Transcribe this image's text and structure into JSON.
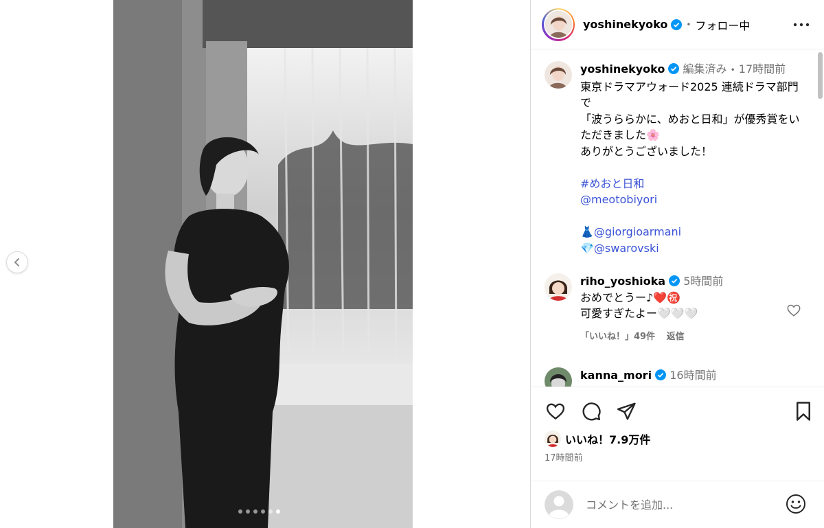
{
  "post": {
    "author": "yoshinekyoko",
    "follow_status": "フォロー中",
    "separator": "•",
    "carousel": {
      "count": 6,
      "active_index": 5
    }
  },
  "caption": {
    "author": "yoshinekyoko",
    "edited": "編集済み",
    "separator": "•",
    "time": "17時間前",
    "lines": [
      "東京ドラマアウォード2025 連続ドラマ部門で",
      "「波うららかに、めおと日和」が優秀賞をいただきました🌸",
      "ありがとうございました！"
    ],
    "hashtag": "#めおと日和",
    "mention1": "@meotobiyori",
    "dress_emoji": "👗",
    "mention2": "@giorgioarmani",
    "gem_emoji": "💎",
    "mention3": "@swarovski"
  },
  "comments": [
    {
      "user": "riho_yoshioka",
      "time": "5時間前",
      "line1": "おめでとうー♪❤️㊗️",
      "line2": "可愛すぎたよー🤍🤍🤍",
      "likes": "「いいね！」49件",
      "reply": "返信"
    },
    {
      "user": "kanna_mori",
      "time": "16時間前"
    }
  ],
  "likes_summary": "いいね！7.9万件",
  "timestamp": "17時間前",
  "comment_box": {
    "placeholder": "コメントを追加..."
  },
  "colors": {
    "link": "#3a53d6",
    "verified": "#0095f6",
    "muted": "#737373",
    "border": "#dbdbdb"
  },
  "icons": [
    "chevron-left-icon",
    "more-icon",
    "verified-icon",
    "heart-icon",
    "comment-icon",
    "share-icon",
    "bookmark-icon",
    "emoji-icon"
  ]
}
